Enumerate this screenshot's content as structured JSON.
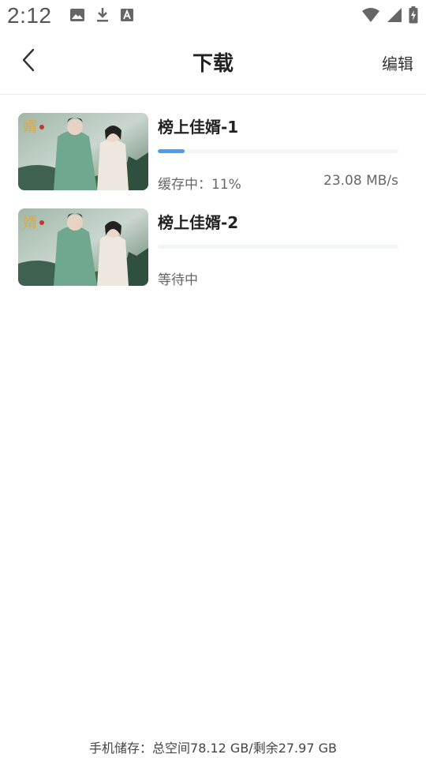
{
  "status_bar": {
    "time": "2:12",
    "left_icons": [
      "image-icon",
      "download-icon",
      "font-icon"
    ],
    "right_icons": [
      "wifi-icon",
      "cellular-signal-icon",
      "battery-charging-icon"
    ]
  },
  "header": {
    "title": "下载",
    "edit_label": "编辑"
  },
  "downloads": [
    {
      "title": "榜上佳婿-1",
      "progress": 0.11,
      "status": "缓存中：11%",
      "speed": "23.08 MB/s"
    },
    {
      "title": "榜上佳婿-2",
      "progress": 0,
      "status": "等待中",
      "speed": ""
    }
  ],
  "footer": {
    "storage_text": "手机储存：总空间78.12 GB/剩余27.97 GB"
  },
  "colors": {
    "progress": "#4a9df0",
    "track": "#f3f4f6",
    "divider": "#ececec"
  }
}
